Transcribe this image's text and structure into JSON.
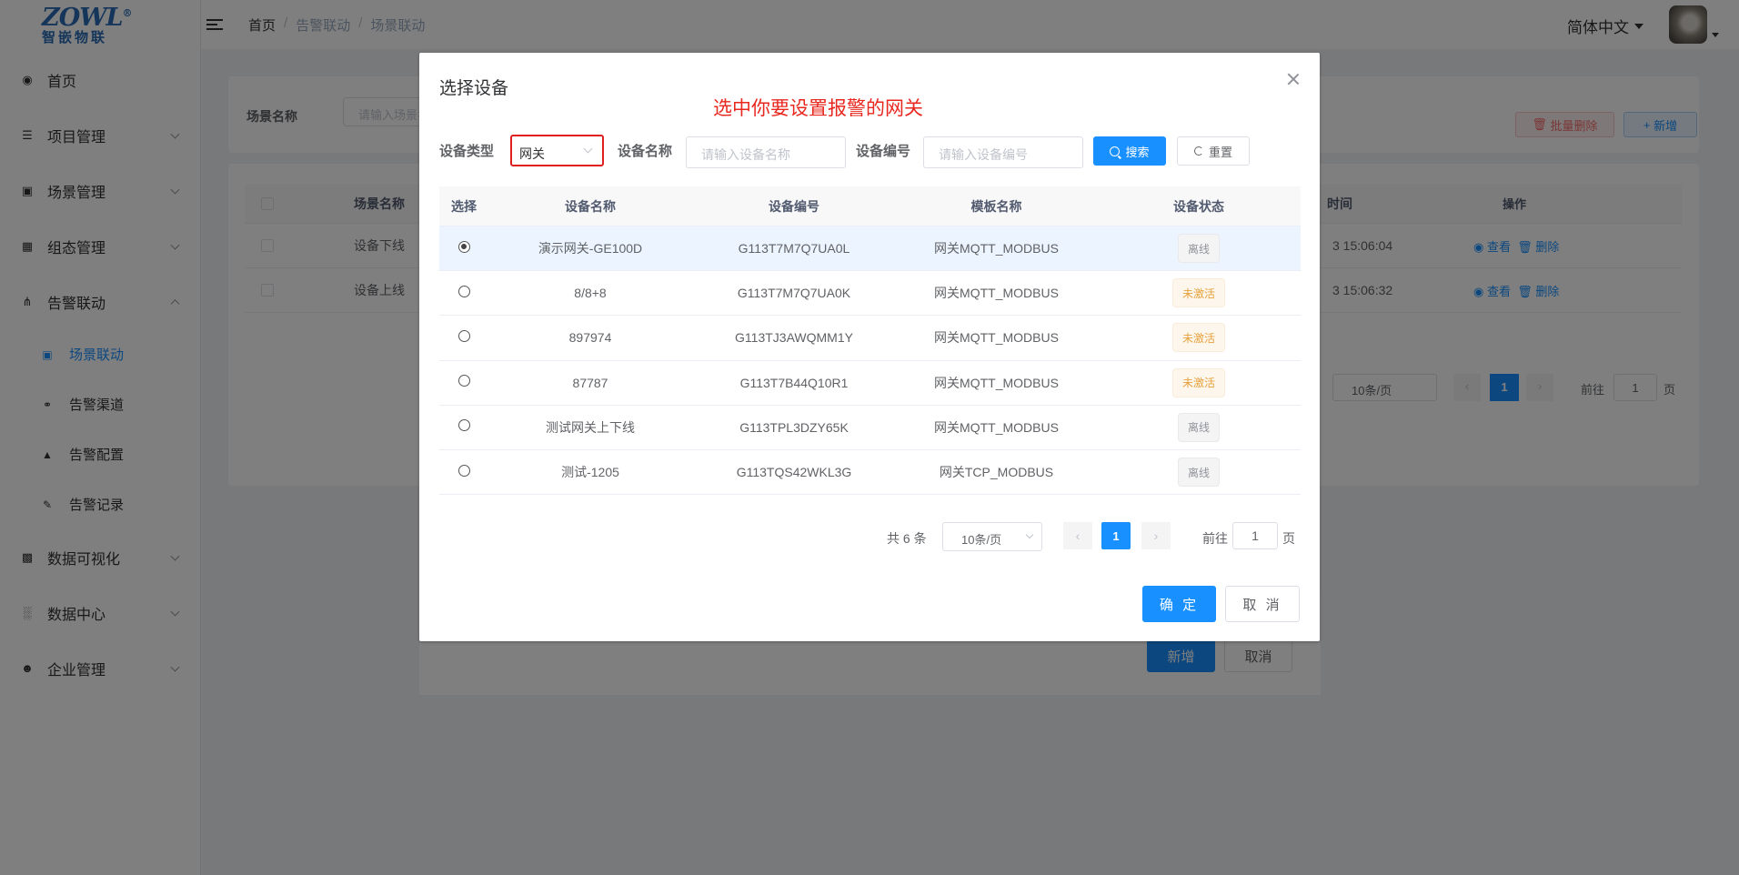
{
  "logo": {
    "main": "ZOWL",
    "mark": "®",
    "sub": "智嵌物联"
  },
  "sidebar": {
    "items": [
      {
        "label": "首页",
        "icon": "home-icon"
      },
      {
        "label": "项目管理",
        "icon": "layers-icon"
      },
      {
        "label": "场景管理",
        "icon": "clapper-icon"
      },
      {
        "label": "组态管理",
        "icon": "server-icon"
      },
      {
        "label": "告警联动",
        "icon": "network-icon"
      },
      {
        "label": "数据可视化",
        "icon": "monitor-icon"
      },
      {
        "label": "数据中心",
        "icon": "bar-chart-icon"
      },
      {
        "label": "企业管理",
        "icon": "user-gear-icon"
      }
    ],
    "sub_items": [
      {
        "label": "场景联动",
        "icon": "clapper-icon"
      },
      {
        "label": "告警渠道",
        "icon": "link-icon"
      },
      {
        "label": "告警配置",
        "icon": "bell-icon"
      },
      {
        "label": "告警记录",
        "icon": "edit-icon"
      }
    ]
  },
  "header": {
    "breadcrumb": [
      "首页",
      "告警联动",
      "场景联动"
    ],
    "language": "简体中文"
  },
  "background": {
    "search_label": "场景名称",
    "search_placeholder": "请输入场景名称",
    "batch_delete": "批量删除",
    "add": "新增",
    "columns": {
      "name": "场景名称",
      "time": "时间",
      "ops": "操作"
    },
    "rows": [
      {
        "name": "设备下线",
        "time": "3 15:06:04"
      },
      {
        "name": "设备上线",
        "time": "3 15:06:32"
      }
    ],
    "op_view": "查看",
    "op_delete": "删除",
    "page_size": "10条/页",
    "page": "1",
    "goto_prefix": "前往",
    "goto_value": "1",
    "goto_suffix": "页",
    "dialog_add": "新增",
    "dialog_cancel": "取消"
  },
  "dialog": {
    "title": "选择设备",
    "annotation": "选中你要设置报警的网关",
    "filters": {
      "type_label": "设备类型",
      "type_value": "网关",
      "name_label": "设备名称",
      "name_placeholder": "请输入设备名称",
      "code_label": "设备编号",
      "code_placeholder": "请输入设备编号",
      "search": "搜索",
      "reset": "重置"
    },
    "columns": [
      "选择",
      "设备名称",
      "设备编号",
      "模板名称",
      "设备状态"
    ],
    "rows": [
      {
        "name": "演示网关-GE100D",
        "code": "G113T7M7Q7UA0L",
        "template": "网关MQTT_MODBUS",
        "status": "离线",
        "selected": true
      },
      {
        "name": "8/8+8",
        "code": "G113T7M7Q7UA0K",
        "template": "网关MQTT_MODBUS",
        "status": "未激活",
        "selected": false
      },
      {
        "name": "897974",
        "code": "G113TJ3AWQMM1Y",
        "template": "网关MQTT_MODBUS",
        "status": "未激活",
        "selected": false
      },
      {
        "name": "87787",
        "code": "G113T7B44Q10R1",
        "template": "网关MQTT_MODBUS",
        "status": "未激活",
        "selected": false
      },
      {
        "name": "测试网关上下线",
        "code": "G113TPL3DZY65K",
        "template": "网关MQTT_MODBUS",
        "status": "离线",
        "selected": false
      },
      {
        "name": "测试-1205",
        "code": "G113TQS42WKL3G",
        "template": "网关TCP_MODBUS",
        "status": "离线",
        "selected": false
      }
    ],
    "pagination": {
      "total": "共 6 条",
      "page_size": "10条/页",
      "current": "1",
      "goto_prefix": "前往",
      "goto_value": "1",
      "goto_suffix": "页"
    },
    "confirm": "确 定",
    "cancel": "取 消"
  },
  "colors": {
    "primary": "#1890ff",
    "annotation": "#e8281f",
    "offline": "#909399",
    "inactive": "#e6a23c"
  }
}
